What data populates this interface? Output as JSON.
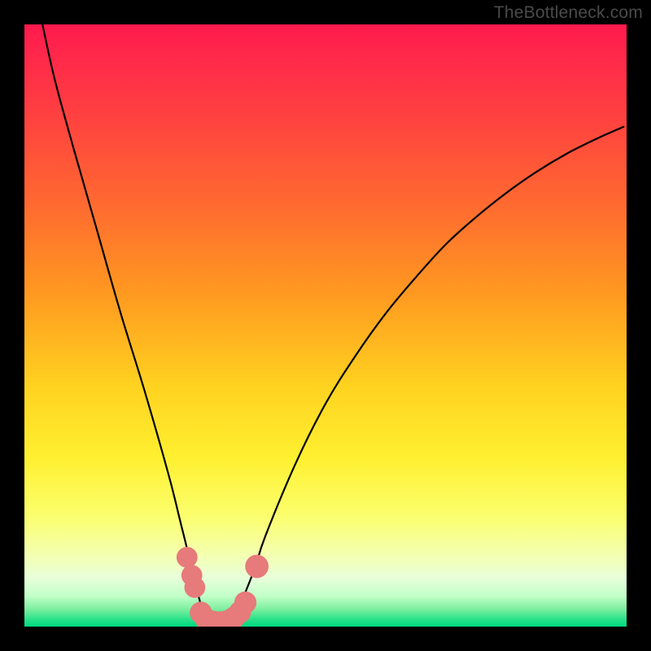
{
  "attribution": "TheBottleneck.com",
  "chart_data": {
    "type": "line",
    "title": "",
    "xlabel": "",
    "ylabel": "",
    "xlim": [
      0,
      100
    ],
    "ylim": [
      0,
      100
    ],
    "series": [
      {
        "name": "bottleneck-curve",
        "x": [
          3,
          5,
          8,
          12,
          16,
          20,
          24,
          26,
          28,
          29.5,
          31,
          33,
          35,
          38,
          40,
          45,
          50,
          55,
          60,
          65,
          70,
          75,
          80,
          85,
          90,
          95,
          99.5
        ],
        "y": [
          100,
          91,
          80,
          66,
          52,
          39,
          25,
          17,
          9,
          3,
          0.5,
          0.5,
          2,
          9,
          15,
          27,
          37,
          45,
          52,
          58,
          63.5,
          68,
          72,
          75.5,
          78.5,
          81,
          83
        ]
      }
    ],
    "markers": {
      "name": "highlight-points",
      "color": "#e77a7a",
      "points": [
        {
          "x": 27.0,
          "y": 11.5,
          "r": 1.2
        },
        {
          "x": 27.8,
          "y": 8.5,
          "r": 1.2
        },
        {
          "x": 28.3,
          "y": 6.5,
          "r": 1.2
        },
        {
          "x": 29.3,
          "y": 2.3,
          "r": 1.3
        },
        {
          "x": 30.2,
          "y": 1.2,
          "r": 1.3
        },
        {
          "x": 31.3,
          "y": 0.8,
          "r": 1.3
        },
        {
          "x": 32.5,
          "y": 0.7,
          "r": 1.3
        },
        {
          "x": 33.7,
          "y": 0.9,
          "r": 1.3
        },
        {
          "x": 34.8,
          "y": 1.5,
          "r": 1.3
        },
        {
          "x": 35.8,
          "y": 2.4,
          "r": 1.3
        },
        {
          "x": 36.7,
          "y": 4.0,
          "r": 1.3
        },
        {
          "x": 38.6,
          "y": 10.0,
          "r": 1.4
        }
      ]
    },
    "background_gradient": {
      "top_color": "#ff1a4d",
      "mid_color": "#fff030",
      "bottom_color": "#00d880"
    }
  }
}
